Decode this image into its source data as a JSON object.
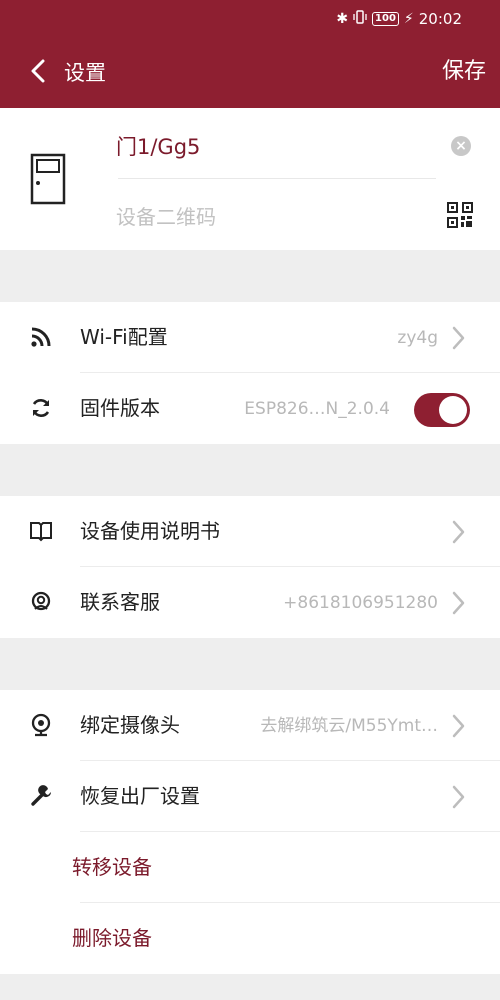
{
  "status_bar": {
    "battery": "100",
    "time": "20:02"
  },
  "nav": {
    "title": "设置",
    "save_label": "保存"
  },
  "device": {
    "name": "门1/Gg5",
    "qr_placeholder": "设备二维码"
  },
  "network": {
    "wifi": {
      "label": "Wi-Fi配置",
      "value": "zy4g"
    },
    "firmware": {
      "label": "固件版本",
      "value": "ESP826…N_2.0.4",
      "toggle_on": true
    }
  },
  "support": {
    "manual": {
      "label": "设备使用说明书"
    },
    "service": {
      "label": "联系客服",
      "value": "+8618106951280"
    }
  },
  "advanced": {
    "camera": {
      "label": "绑定摄像头",
      "value": "去解绑筑云/M55Ymt…"
    },
    "reset": {
      "label": "恢复出厂设置"
    },
    "transfer": {
      "label": "转移设备"
    },
    "delete": {
      "label": "删除设备"
    }
  },
  "colors": {
    "primary": "#8e1f31",
    "accent_text": "#7b1a2b",
    "background": "#eeeeee"
  },
  "icons": [
    "back-icon",
    "door-icon",
    "clear-icon",
    "qr-code-icon",
    "wifi-icon",
    "refresh-icon",
    "book-icon",
    "headset-icon",
    "webcam-icon",
    "wrench-icon",
    "chevron-right-icon"
  ]
}
